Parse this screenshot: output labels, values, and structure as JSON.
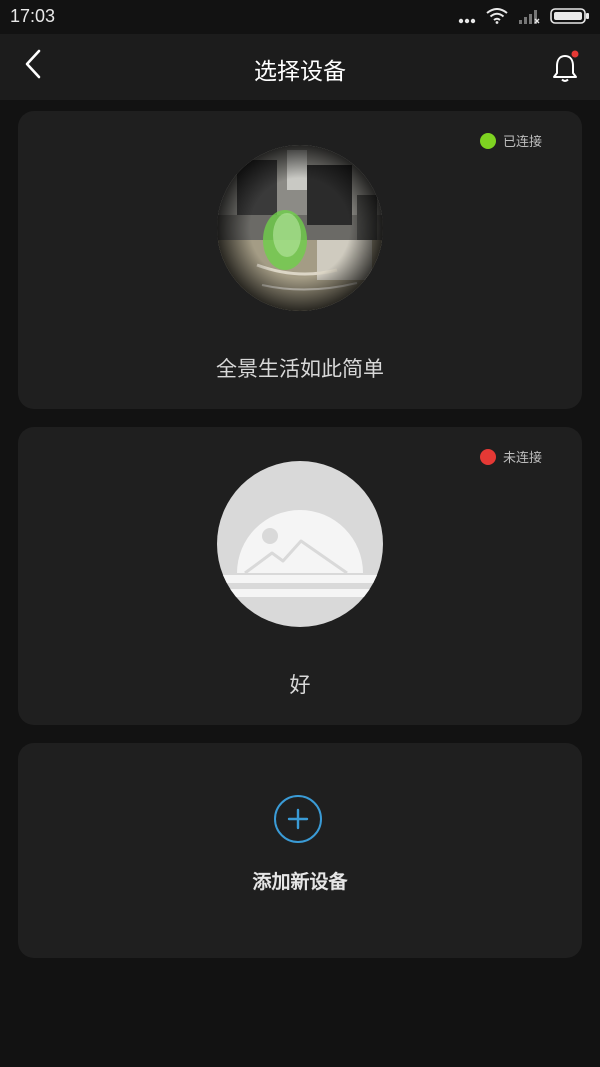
{
  "status_bar": {
    "time": "17:03",
    "icons": [
      "more-dots-icon",
      "wifi-icon",
      "signal-icon",
      "battery-icon"
    ]
  },
  "header": {
    "title": "选择设备",
    "back_icon": "chevron-left-icon",
    "bell_icon": "bell-icon",
    "bell_badge_color": "#e53935"
  },
  "devices": [
    {
      "name": "全景生活如此简单",
      "status": "已连接",
      "status_color": "#7ed321",
      "thumbnail": "camera-preview-image"
    },
    {
      "name": "好",
      "status": "未连接",
      "status_color": "#e53935",
      "thumbnail": "placeholder-image-icon"
    }
  ],
  "add_device": {
    "label": "添加新设备",
    "icon": "plus-icon",
    "accent_color": "#3a9bd6"
  }
}
